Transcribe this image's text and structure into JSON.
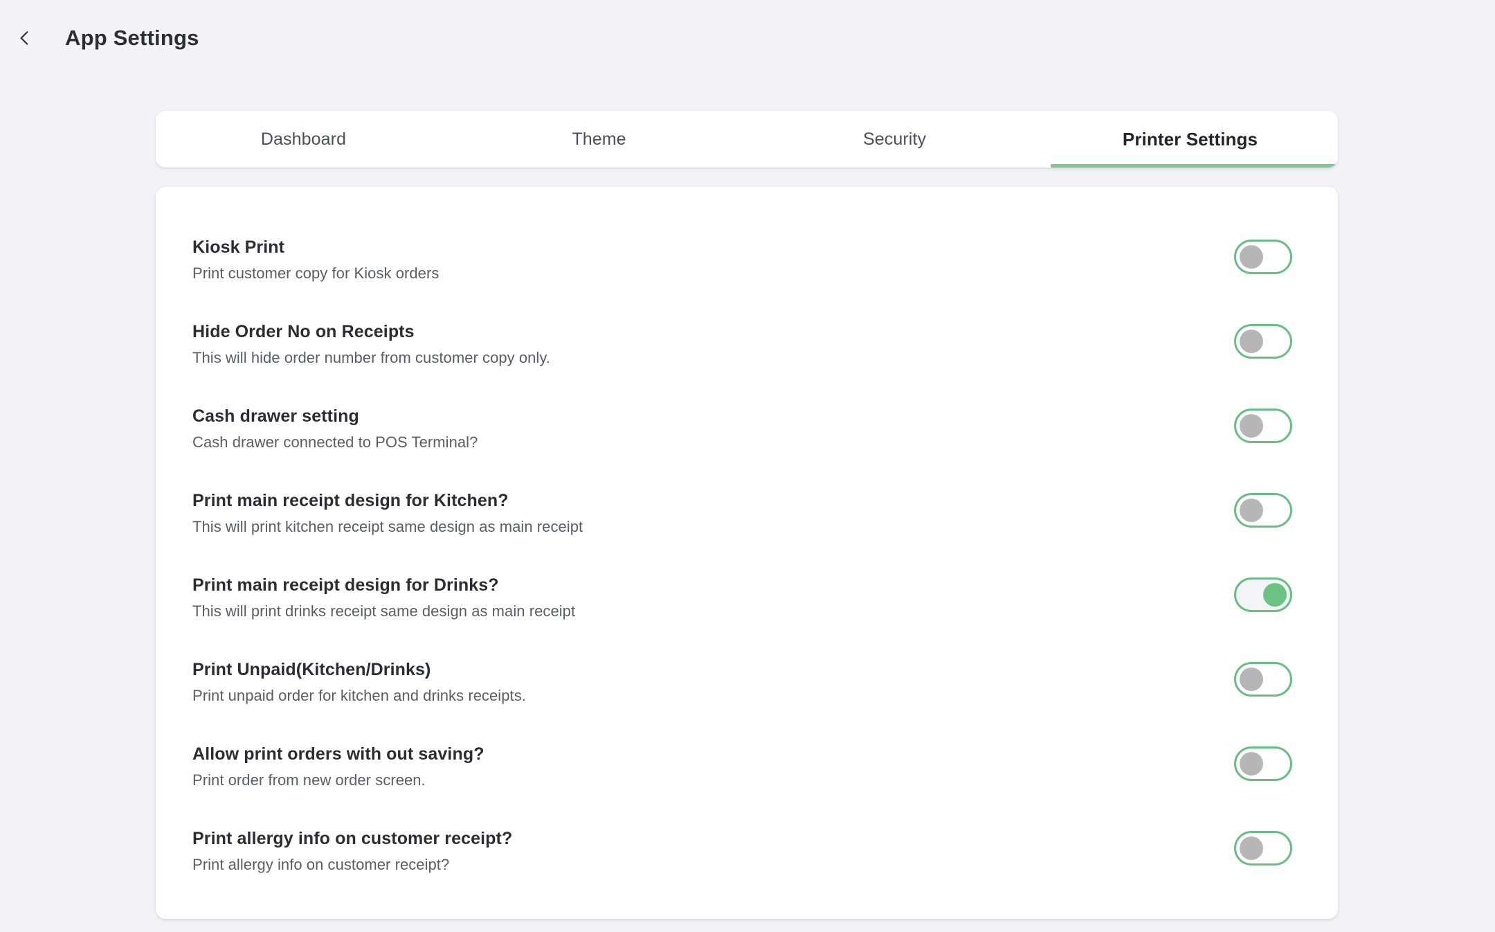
{
  "header": {
    "back_icon": "chevron-left-icon",
    "title": "App Settings"
  },
  "tabs": [
    {
      "label": "Dashboard",
      "active": false
    },
    {
      "label": "Theme",
      "active": false
    },
    {
      "label": "Security",
      "active": false
    },
    {
      "label": "Printer Settings",
      "active": true
    }
  ],
  "colors": {
    "page_background": "#f1f3f7",
    "card_background": "#ffffff",
    "accent_green": "#7ec998",
    "toggle_border": "#6bbd86",
    "toggle_knob_off": "#b6b6b6",
    "toggle_knob_on": "#6cc185",
    "title_text": "#2a2d33",
    "desc_text": "#585d66"
  },
  "settings": [
    {
      "title": "Kiosk Print",
      "description": "Print customer copy for Kiosk orders",
      "enabled": false
    },
    {
      "title": "Hide Order No on Receipts",
      "description": "This will hide order number from customer copy only.",
      "enabled": false
    },
    {
      "title": "Cash drawer setting",
      "description": "Cash drawer connected to POS Terminal?",
      "enabled": false
    },
    {
      "title": "Print main receipt design for Kitchen?",
      "description": "This will print kitchen receipt same design as main receipt",
      "enabled": false
    },
    {
      "title": "Print main receipt design for Drinks?",
      "description": "This will print drinks receipt same design as main receipt",
      "enabled": true
    },
    {
      "title": "Print Unpaid(Kitchen/Drinks)",
      "description": "Print unpaid order for kitchen and drinks receipts.",
      "enabled": false
    },
    {
      "title": "Allow print orders with out saving?",
      "description": "Print order from new order screen.",
      "enabled": false
    },
    {
      "title": "Print allergy info on customer receipt?",
      "description": "Print allergy info on customer receipt?",
      "enabled": false
    }
  ]
}
